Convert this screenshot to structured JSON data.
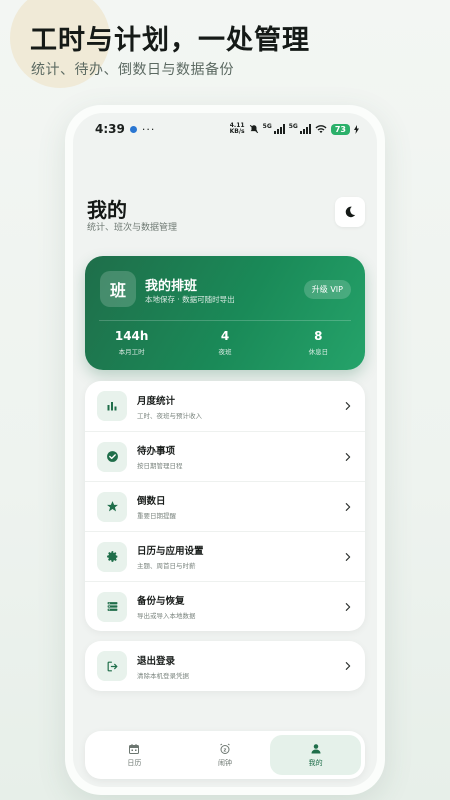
{
  "promo": {
    "title": "工时与计划，一处管理",
    "subtitle": "统计、待办、倒数日与数据备份"
  },
  "status_bar": {
    "time": "4:39",
    "more": "···",
    "net_speed_value": "4.11",
    "net_speed_unit": "KB/s",
    "sim1": "5G",
    "sim2": "5G",
    "battery": "73"
  },
  "header": {
    "title": "我的",
    "subtitle": "统计、班次与数据管理"
  },
  "hero": {
    "badge": "班",
    "title": "我的排班",
    "subtitle": "本地保存 · 数据可随时导出",
    "vip_label": "升级 VIP",
    "stats": [
      {
        "value": "144h",
        "label": "本月工时"
      },
      {
        "value": "4",
        "label": "夜班"
      },
      {
        "value": "8",
        "label": "休息日"
      }
    ]
  },
  "menu": {
    "items": [
      {
        "title": "月度统计",
        "subtitle": "工时、夜班与预计收入",
        "icon": "bar-chart-icon"
      },
      {
        "title": "待办事项",
        "subtitle": "按日期管理日程",
        "icon": "check-circle-icon"
      },
      {
        "title": "倒数日",
        "subtitle": "重要日期提醒",
        "icon": "star-icon"
      },
      {
        "title": "日历与应用设置",
        "subtitle": "主题、周首日与时薪",
        "icon": "gear-icon"
      },
      {
        "title": "备份与恢复",
        "subtitle": "导出或导入本地数据",
        "icon": "storage-icon"
      }
    ]
  },
  "logout": {
    "title": "退出登录",
    "subtitle": "清除本机登录凭据",
    "icon": "logout-icon"
  },
  "nav": {
    "items": [
      {
        "label": "日历",
        "icon": "calendar-icon",
        "active": false
      },
      {
        "label": "闹钟",
        "icon": "alarm-icon",
        "active": false
      },
      {
        "label": "我的",
        "icon": "person-icon",
        "active": true
      }
    ]
  },
  "colors": {
    "accent": "#1f6e4a",
    "accent_light": "#e8f2ec",
    "background": "#f0f3f1"
  }
}
